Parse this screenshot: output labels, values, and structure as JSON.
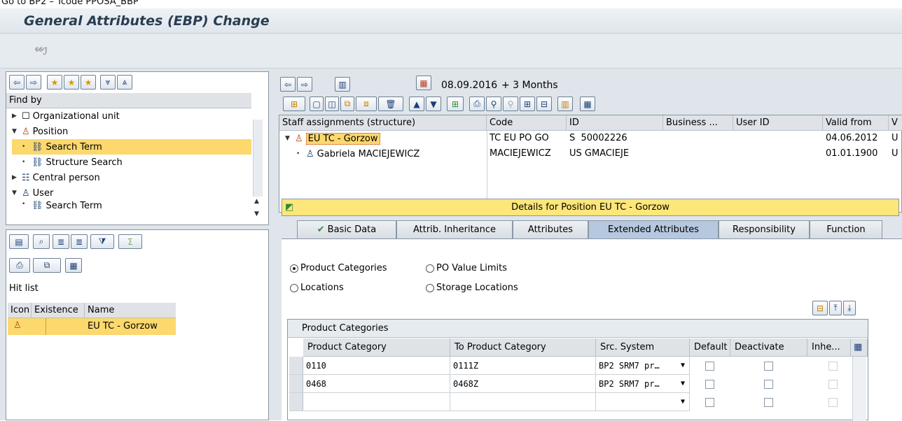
{
  "caption": "Go to BP2 – Tcode PPOSA_BBP",
  "window_title": "General Attributes (EBP) Change",
  "left_nav": {
    "find_by": "Find by",
    "tree": [
      {
        "label": "Organizational unit"
      },
      {
        "label": "Position"
      },
      {
        "label": "Search Term"
      },
      {
        "label": "Structure Search"
      },
      {
        "label": "Central person"
      },
      {
        "label": "User"
      },
      {
        "label": "Search Term"
      }
    ],
    "hit_list": "Hit list",
    "columns": [
      "Icon",
      "Existence",
      "Name"
    ],
    "hit_row_name": "EU TC - Gorzow"
  },
  "right": {
    "date": "08.09.2016",
    "range": "+ 3 Months",
    "columns": [
      "Staff assignments (structure)",
      "Code",
      "ID",
      "Business ...",
      "User ID",
      "Valid from",
      "V"
    ],
    "rows": [
      {
        "name": "EU TC - Gorzow",
        "code": "TC EU PO GO",
        "id": "S  50002226",
        "valid_from": "04.06.2012",
        "v": "U"
      },
      {
        "name": "Gabriela MACIEJEWICZ",
        "code": "MACIEJEWICZ",
        "id": "US GMACIEJE",
        "valid_from": "01.01.1900",
        "v": "U"
      }
    ],
    "details_title": "Details for Position EU TC - Gorzow",
    "tabs": [
      "Basic Data",
      "Attrib. Inheritance",
      "Attributes",
      "Extended Attributes",
      "Responsibility",
      "Function"
    ],
    "radios": [
      "Product Categories",
      "PO Value Limits",
      "Locations",
      "Storage Locations"
    ],
    "grid_title": "Product Categories",
    "grid_columns": [
      "Product Category",
      "To Product Category",
      "Src. System",
      "Default",
      "Deactivate",
      "Inhe..."
    ],
    "grid_rows": [
      {
        "from": "0110",
        "to": "0111Z",
        "src": "BP2 SRM7 pr…"
      },
      {
        "from": "0468",
        "to": "0468Z",
        "src": "BP2 SRM7 pr…"
      },
      {
        "from": "",
        "to": "",
        "src": ""
      }
    ]
  }
}
